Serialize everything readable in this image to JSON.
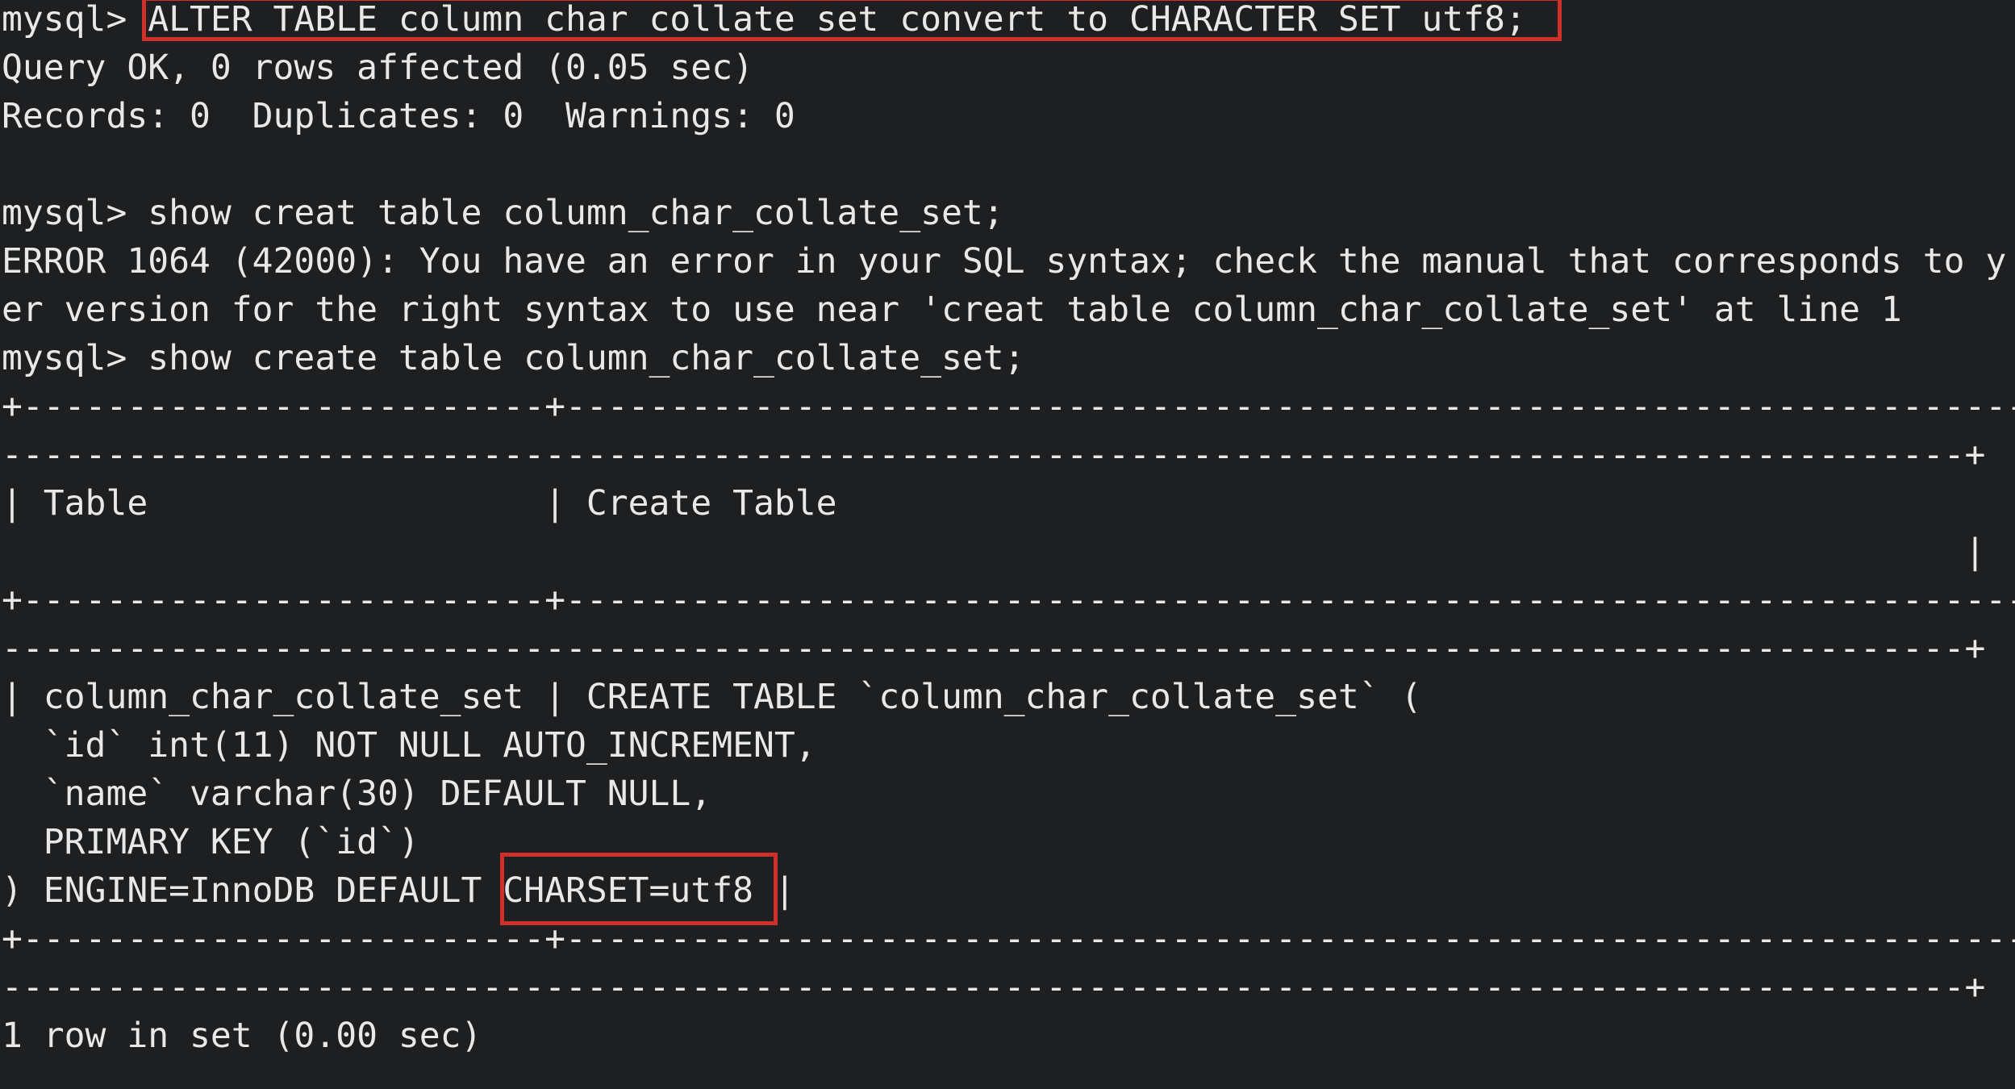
{
  "terminal": {
    "lines": [
      "mysql> ALTER TABLE column_char_collate_set convert to CHARACTER SET utf8;",
      "Query OK, 0 rows affected (0.05 sec)",
      "Records: 0  Duplicates: 0  Warnings: 0",
      "",
      "mysql> show creat table column_char_collate_set;",
      "ERROR 1064 (42000): You have an error in your SQL syntax; check the manual that corresponds to y",
      "er version for the right syntax to use near 'creat table column_char_collate_set' at line 1",
      "mysql> show create table column_char_collate_set;",
      "+-------------------------+------------------------------------------------------------------------",
      "----------------------------------------------------------------------------------------------+",
      "| Table                   | Create Table",
      "                                                                                              |",
      "+-------------------------+------------------------------------------------------------------------",
      "----------------------------------------------------------------------------------------------+",
      "| column_char_collate_set | CREATE TABLE `column_char_collate_set` (",
      "  `id` int(11) NOT NULL AUTO_INCREMENT,",
      "  `name` varchar(30) DEFAULT NULL,",
      "  PRIMARY KEY (`id`)",
      ") ENGINE=InnoDB DEFAULT CHARSET=utf8 |",
      "+-------------------------+------------------------------------------------------------------------",
      "----------------------------------------------------------------------------------------------+",
      "1 row in set (0.00 sec)"
    ]
  },
  "colors": {
    "background": "#1e1f21",
    "text": "#e8e8e8",
    "highlight": "#d0302a"
  }
}
